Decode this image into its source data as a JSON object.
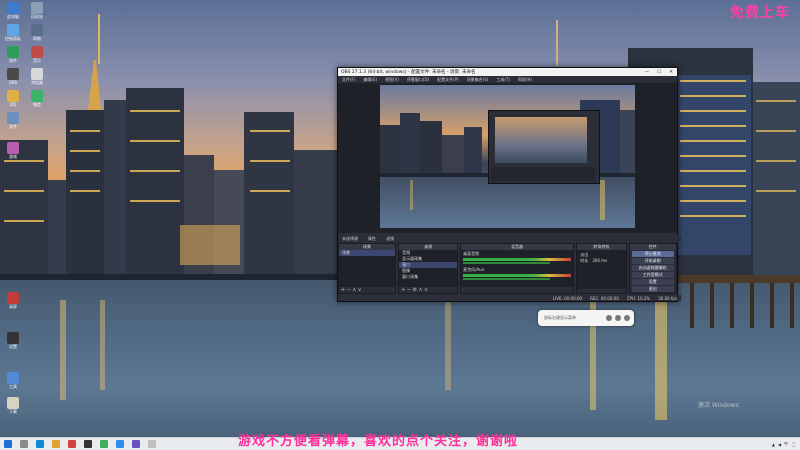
{
  "overlay": {
    "top_right": "免费上车",
    "caption": "游戏不方便看弹幕，喜欢的点个关注，谢谢啦",
    "activate_windows": "激活 Windows"
  },
  "desktop_icons": [
    {
      "label": "此电脑"
    },
    {
      "label": "回收站"
    },
    {
      "label": "控制面板"
    },
    {
      "label": "网络"
    },
    {
      "label": "软件"
    },
    {
      "label": "音乐"
    },
    {
      "label": "OBS"
    },
    {
      "label": "浏览器"
    },
    {
      "label": "QQ"
    },
    {
      "label": "微信"
    },
    {
      "label": "文件"
    },
    {
      "label": "游戏"
    },
    {
      "label": "录屏"
    },
    {
      "label": "设置"
    },
    {
      "label": "工具"
    },
    {
      "label": "下载"
    }
  ],
  "obs": {
    "title": "OBS 27.1.3 (64-bit, windows) - 配置文件: 未命名 - 场景: 未命名",
    "menu": [
      "文件(F)",
      "编辑(E)",
      "视图(V)",
      "停靠窗口(D)",
      "配置文件(P)",
      "场景集合(S)",
      "工具(T)",
      "帮助(H)"
    ],
    "panel_bar": [
      "未选择源",
      "属性",
      "滤镜"
    ],
    "docks": {
      "scenes": {
        "header": "场景",
        "items": [
          "场景"
        ],
        "footer": "+ − ∧ ∨"
      },
      "sources": {
        "header": "来源",
        "items": [
          "音频",
          "显示器采集",
          "窗口",
          "图像",
          "窗口采集"
        ],
        "footer": "+ − ⚙ ∧ ∨"
      },
      "mixer": {
        "header": "混音器",
        "tracks": [
          "桌面音频",
          "麦克风/Aux"
        ]
      },
      "transitions": {
        "header": "转场特效",
        "type": "淡出",
        "duration_label": "时长",
        "duration": "300 ms"
      },
      "controls": {
        "header": "控件",
        "buttons": [
          "停止推流",
          "开始录制",
          "启动虚拟摄像机",
          "工作室模式",
          "设置",
          "退出"
        ]
      }
    },
    "status": [
      "LIVE: 00:00:00",
      "REC: 00:00:00",
      "CPU: 10.2%",
      "30.00 fps"
    ]
  },
  "pill": {
    "text": "鼠标右键显示菜单"
  }
}
